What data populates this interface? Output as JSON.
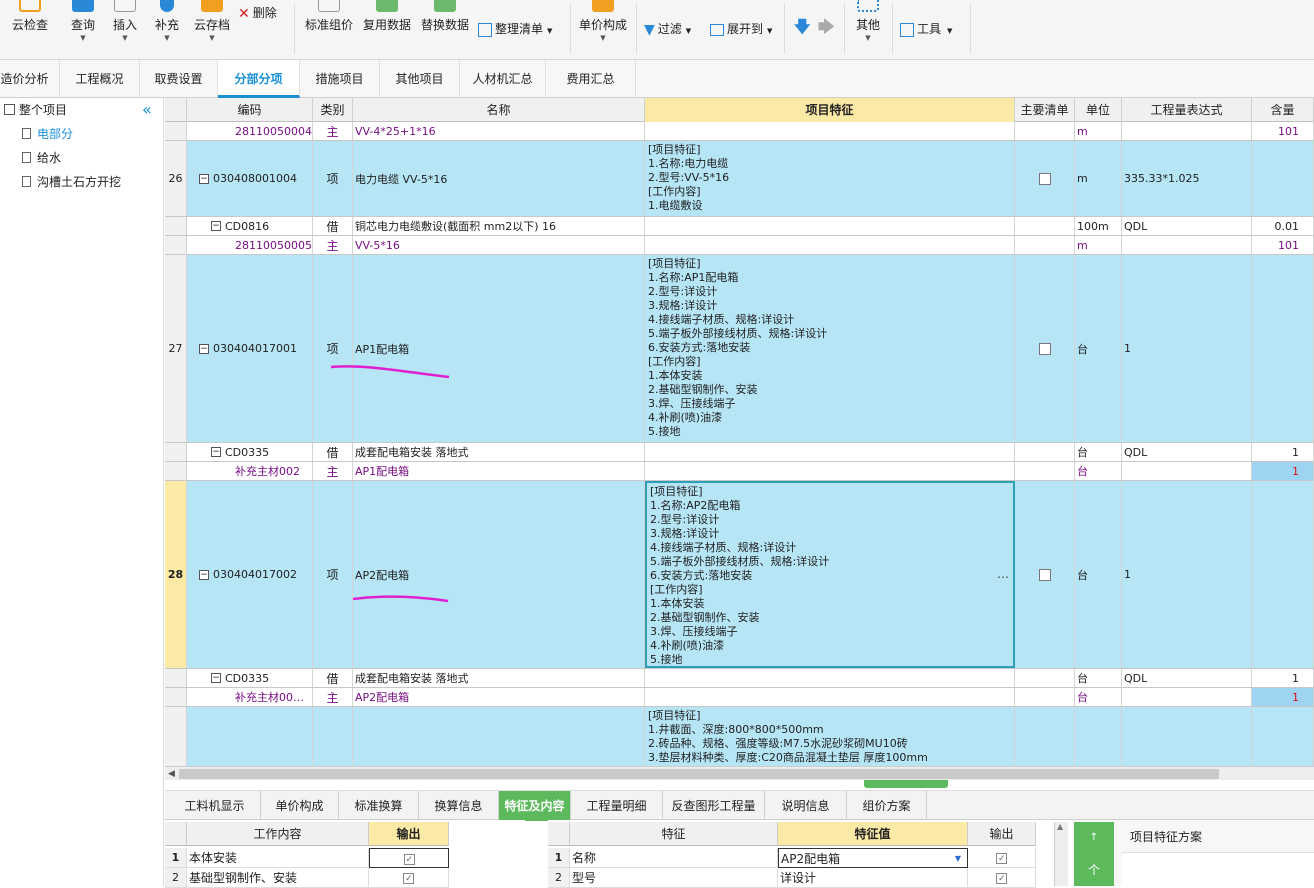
{
  "toolbar": {
    "cloud_check": "云检查",
    "query": "查询",
    "insert": "插入",
    "supplement": "补充",
    "cloud_save": "云存档",
    "delete": "删除",
    "std_group": "标准组价",
    "reuse_data": "复用数据",
    "replace_data": "替换数据",
    "organize_list": "整理清单",
    "unit_price_comp": "单价构成",
    "filter": "过滤",
    "expand_to": "展开到",
    "other": "其他",
    "tools": "工具"
  },
  "module_tabs": [
    "造价分析",
    "工程概况",
    "取费设置",
    "分部分项",
    "措施项目",
    "其他项目",
    "人材机汇总",
    "费用汇总"
  ],
  "active_module_tab": 3,
  "tree": {
    "root": "整个项目",
    "items": [
      "电部分",
      "给水",
      "沟槽土石方开挖"
    ],
    "selected": 0
  },
  "grid": {
    "headers": {
      "code": "编码",
      "type": "类别",
      "name": "名称",
      "feature": "项目特征",
      "main_list": "主要清单",
      "unit": "单位",
      "expr": "工程量表达式",
      "qty": "含量"
    },
    "rows": [
      {
        "num": "",
        "code": "28110050004",
        "type": "主",
        "name": "VV-4*25+1*16",
        "feature": "",
        "unit": "m",
        "expr": "",
        "qty": "101",
        "style": "material"
      },
      {
        "num": "26",
        "code": "030408001004",
        "type": "项",
        "name": "电力电缆 VV-5*16",
        "feature": "[项目特征]\n1.名称:电力电缆\n2.型号:VV-5*16\n[工作内容]\n1.电缆敷设",
        "unit": "m",
        "expr": "335.33*1.025",
        "qty": "",
        "style": "item"
      },
      {
        "num": "",
        "code": "CD0816",
        "type": "借",
        "name": "铜芯电力电缆敷设(截面积 mm2以下) 16",
        "feature": "",
        "unit": "100m",
        "expr": "QDL",
        "qty": "0.01",
        "style": "sub"
      },
      {
        "num": "",
        "code": "28110050005",
        "type": "主",
        "name": "VV-5*16",
        "feature": "",
        "unit": "m",
        "expr": "",
        "qty": "101",
        "style": "material"
      },
      {
        "num": "27",
        "code": "030404017001",
        "type": "项",
        "name": "AP1配电箱",
        "feature": "[项目特征]\n1.名称:AP1配电箱\n2.型号:详设计\n3.规格:详设计\n4.接线端子材质、规格:详设计\n5.端子板外部接线材质、规格:详设计\n6.安装方式:落地安装\n[工作内容]\n1.本体安装\n2.基础型钢制作、安装\n3.焊、压接线端子\n4.补刷(喷)油漆\n5.接地",
        "unit": "台",
        "expr": "1",
        "qty": "",
        "style": "item"
      },
      {
        "num": "",
        "code": "CD0335",
        "type": "借",
        "name": "成套配电箱安装 落地式",
        "feature": "",
        "unit": "台",
        "expr": "QDL",
        "qty": "1",
        "style": "sub"
      },
      {
        "num": "",
        "code": "补充主材002",
        "type": "主",
        "name": "AP1配电箱",
        "feature": "",
        "unit": "台",
        "expr": "",
        "qty": "1",
        "style": "material-red"
      },
      {
        "num": "28",
        "code": "030404017002",
        "type": "项",
        "name": "AP2配电箱",
        "feature": "[项目特征]\n1.名称:AP2配电箱\n2.型号:详设计\n3.规格:详设计\n4.接线端子材质、规格:详设计\n5.端子板外部接线材质、规格:详设计\n6.安装方式:落地安装\n[工作内容]\n1.本体安装\n2.基础型钢制作、安装\n3.焊、压接线端子\n4.补刷(喷)油漆\n5.接地",
        "unit": "台",
        "expr": "1",
        "qty": "",
        "style": "item-selected"
      },
      {
        "num": "",
        "code": "CD0335",
        "type": "借",
        "name": "成套配电箱安装 落地式",
        "feature": "",
        "unit": "台",
        "expr": "QDL",
        "qty": "1",
        "style": "sub"
      },
      {
        "num": "",
        "code": "补充主材00…",
        "type": "主",
        "name": "AP2配电箱",
        "feature": "",
        "unit": "台",
        "expr": "",
        "qty": "1",
        "style": "material-red"
      },
      {
        "num": "",
        "code": "",
        "type": "",
        "name": "",
        "feature": "[项目特征]\n1.井截面、深度:800*800*500mm\n2.砖品种、规格、强度等级:M7.5水泥砂浆砌MU10砖\n3.垫层材料种类、厚度:C20商品混凝土垫层 厚度100mm",
        "unit": "",
        "expr": "",
        "qty": "",
        "style": "item"
      }
    ],
    "ellipsis": "…"
  },
  "bottom_tabs": [
    "工料机显示",
    "单价构成",
    "标准换算",
    "换算信息",
    "特征及内容",
    "工程量明细",
    "反查图形工程量",
    "说明信息",
    "组价方案"
  ],
  "active_bottom_tab": 4,
  "work_panel": {
    "col_content": "工作内容",
    "col_output": "输出",
    "rows": [
      {
        "num": "1",
        "text": "本体安装"
      },
      {
        "num": "2",
        "text": "基础型钢制作、安装"
      }
    ]
  },
  "feature_panel": {
    "col_feature": "特征",
    "col_value": "特征值",
    "col_output": "输出",
    "rows": [
      {
        "num": "1",
        "feature": "名称",
        "value": "AP2配电箱"
      },
      {
        "num": "2",
        "feature": "型号",
        "value": "详设计"
      }
    ]
  },
  "scheme_panel": {
    "title": "项目特征方案",
    "button_char": "个"
  },
  "colors": {
    "accent": "#1a8fd6",
    "row_blue": "#b6e5f6",
    "feature_header": "#fbe9a6",
    "green_tab": "#5cb95c",
    "material_purple": "#7a0f86",
    "annotation_magenta": "#e020d0"
  }
}
